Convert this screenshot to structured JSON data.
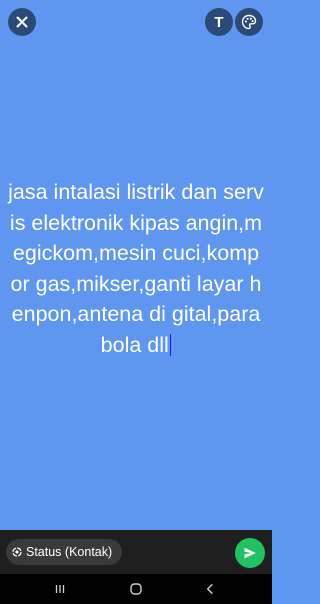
{
  "editor": {
    "status_text": "jasa intalasi listrik dan servis elektronik kipas angin,megickom,mesin cuci,kompor gas,mikser,ganti layar henpon,antena di gital,parabola dll",
    "background_color": "#5f96ef",
    "text_button_label": "T"
  },
  "icons": {
    "close": "close-icon",
    "text": "text-icon",
    "palette": "palette-icon",
    "status_chip": "status-icon",
    "send": "send-icon",
    "recents": "recents-icon",
    "home": "home-icon",
    "back": "back-icon"
  },
  "footer": {
    "audience_label": "Status (Kontak)",
    "send_color": "#21c063"
  }
}
